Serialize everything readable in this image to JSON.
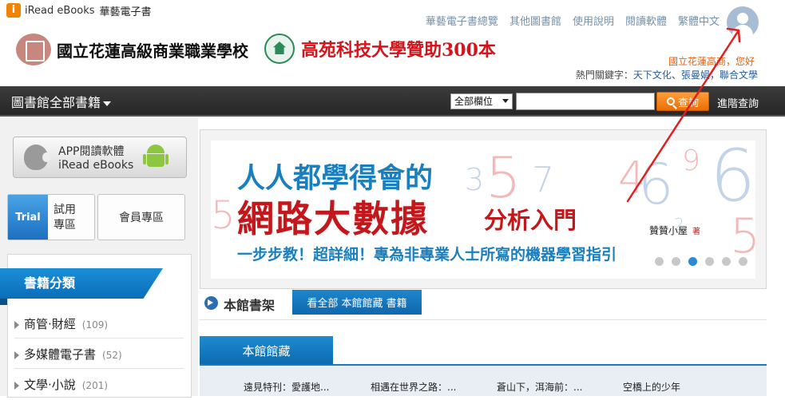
{
  "brand": {
    "mark": "i",
    "name": "iRead eBooks",
    "cn": "華藝電子書"
  },
  "top_links": [
    "華藝電子書總覽",
    "其他圖書館",
    "使用說明",
    "閱讀軟體",
    "繁體中文"
  ],
  "greeting": "國立花蓮高商，您好",
  "hot_keywords": {
    "label": "熱門關鍵字：",
    "items": [
      "天下文化",
      "張曼娟",
      "聯合文學"
    ]
  },
  "schools": {
    "primary": "國立花蓮高級商業職業學校",
    "sponsor": "高苑科技大學贊助300本"
  },
  "nav": {
    "title": "圖書館全部書籍",
    "field_select": "全部欄位",
    "search_placeholder": "",
    "search_button": "查詢",
    "advanced": "進階查詢"
  },
  "sidebar": {
    "app_button": {
      "line1": "APP閱讀軟體",
      "line2": "iRead eBooks"
    },
    "trial": {
      "badge": "Trial",
      "label": "試用專區"
    },
    "member": "會員專區",
    "category_title": "書籍分類",
    "categories": [
      {
        "label": "商管·財經",
        "count": "(109)"
      },
      {
        "label": "多媒體電子書",
        "count": "(52)"
      },
      {
        "label": "文學·小說",
        "count": "(201)"
      }
    ]
  },
  "banner": {
    "line1": "人人都學得會的",
    "line2": "網路大數據",
    "line2b": "分析入門",
    "author": "贊贊小屋",
    "author_mark": "著",
    "line3": "一步步教！超詳細！專為非專業人士所寫的機器學習指引",
    "dots": 6,
    "active_dot": 2
  },
  "shelf": {
    "title": "本館書架",
    "view_all": "看全部 本館館藏 書籍",
    "tab": "本館館藏",
    "books": [
      "遠見特刊：愛護地...",
      "相遇在世界之路：...",
      "蒼山下，洱海前：...",
      "空橋上的少年"
    ]
  },
  "colors": {
    "accent": "#1a7fbe",
    "search": "#ea6f05",
    "banner_red": "#c4171c",
    "annotation": "#e02020"
  }
}
